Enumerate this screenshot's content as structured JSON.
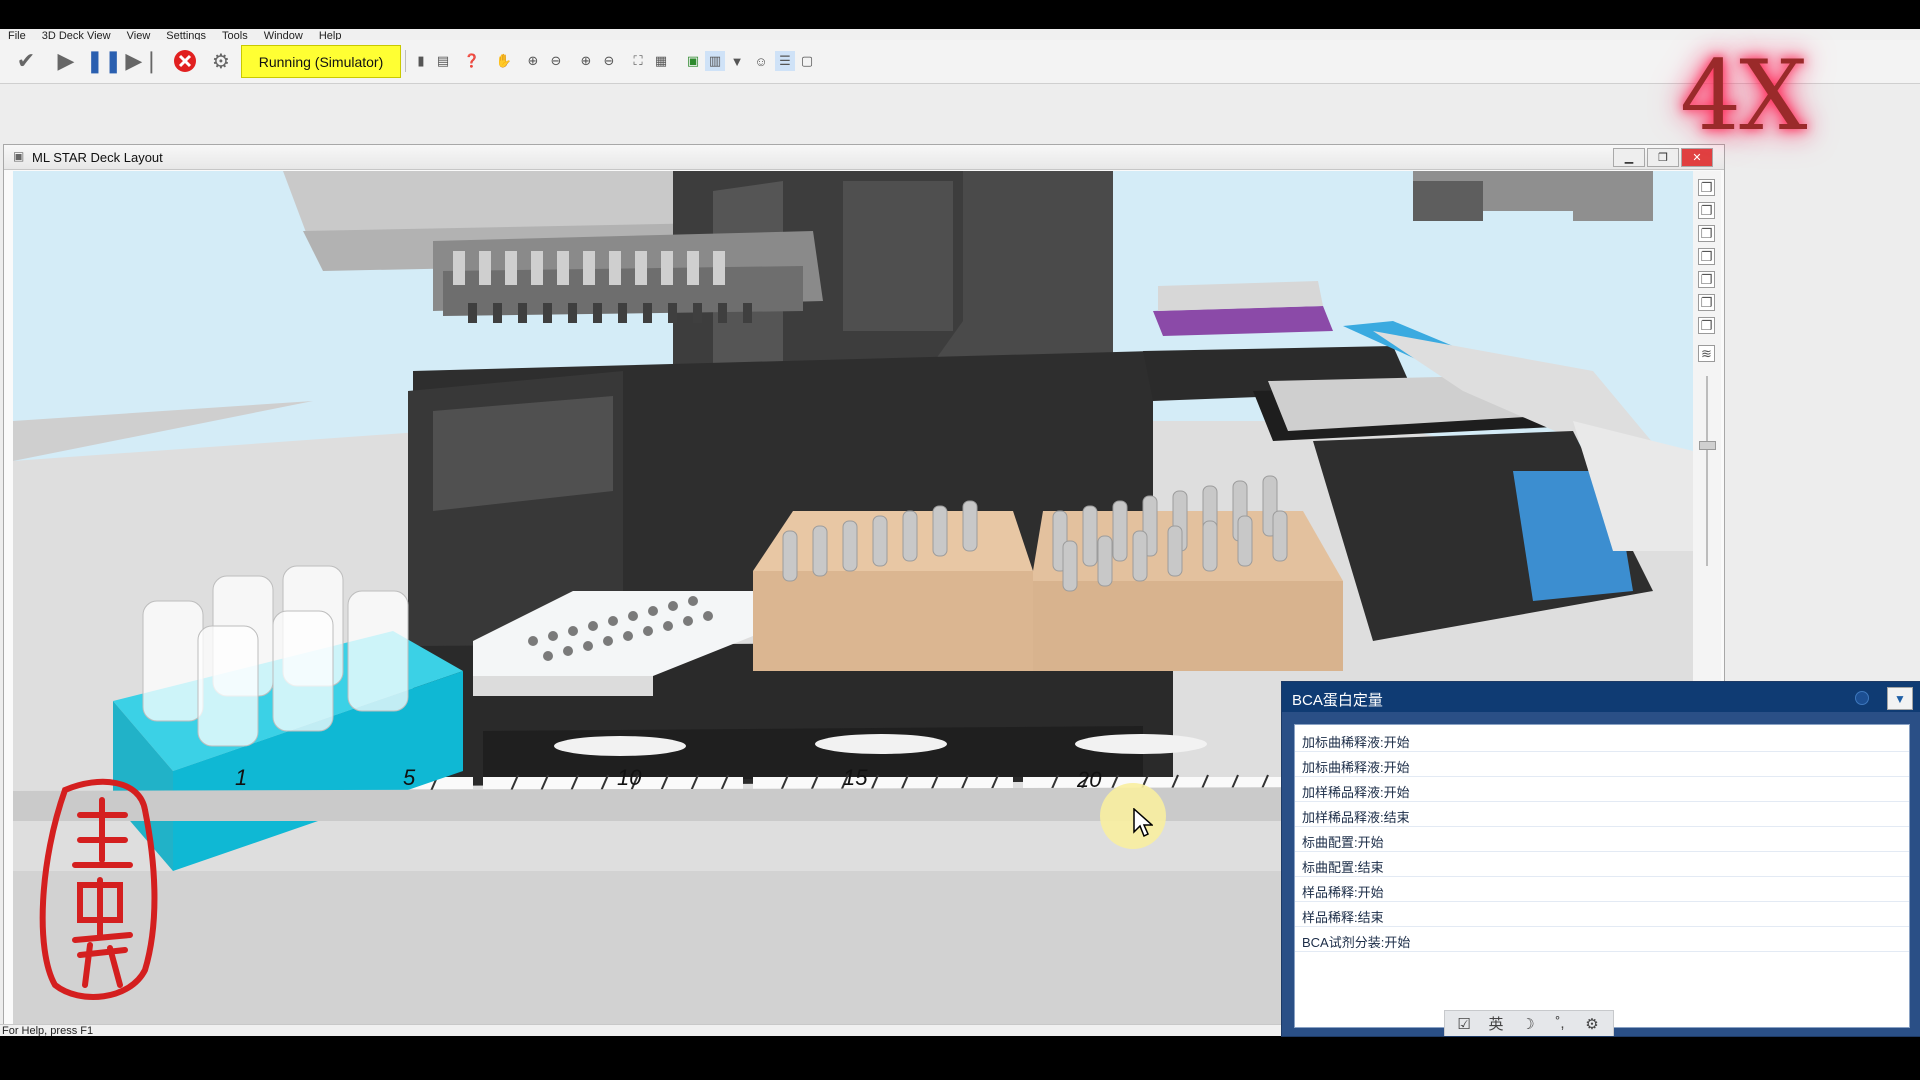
{
  "menu": [
    "File",
    "3D Deck View",
    "View",
    "Settings",
    "Tools",
    "Window",
    "Help"
  ],
  "toolbar": {
    "run_status": "Running (Simulator)",
    "buttons": [
      "check-icon",
      "play-icon",
      "pause-icon",
      "step-icon",
      "abort-icon",
      "gear-icon"
    ]
  },
  "window": {
    "title": "ML STAR Deck Layout",
    "buttons": [
      "minimize",
      "maximize",
      "close"
    ]
  },
  "deck": {
    "track_labels": [
      "1",
      "5",
      "10",
      "15",
      "20"
    ]
  },
  "overlay": {
    "speed": "4X"
  },
  "log_panel": {
    "title": "BCA蛋白定量",
    "entries": [
      "加标曲稀释液:开始",
      "加标曲稀释液:开始",
      "加样稀品释液:开始",
      "加样稀品释液:结束",
      "标曲配置:开始",
      "标曲配置:结束",
      "样品稀释:开始",
      "样品稀释:结束",
      "BCA试剂分装:开始"
    ]
  },
  "ime": {
    "lang": "英"
  },
  "statusbar": {
    "text": "For Help, press F1"
  }
}
